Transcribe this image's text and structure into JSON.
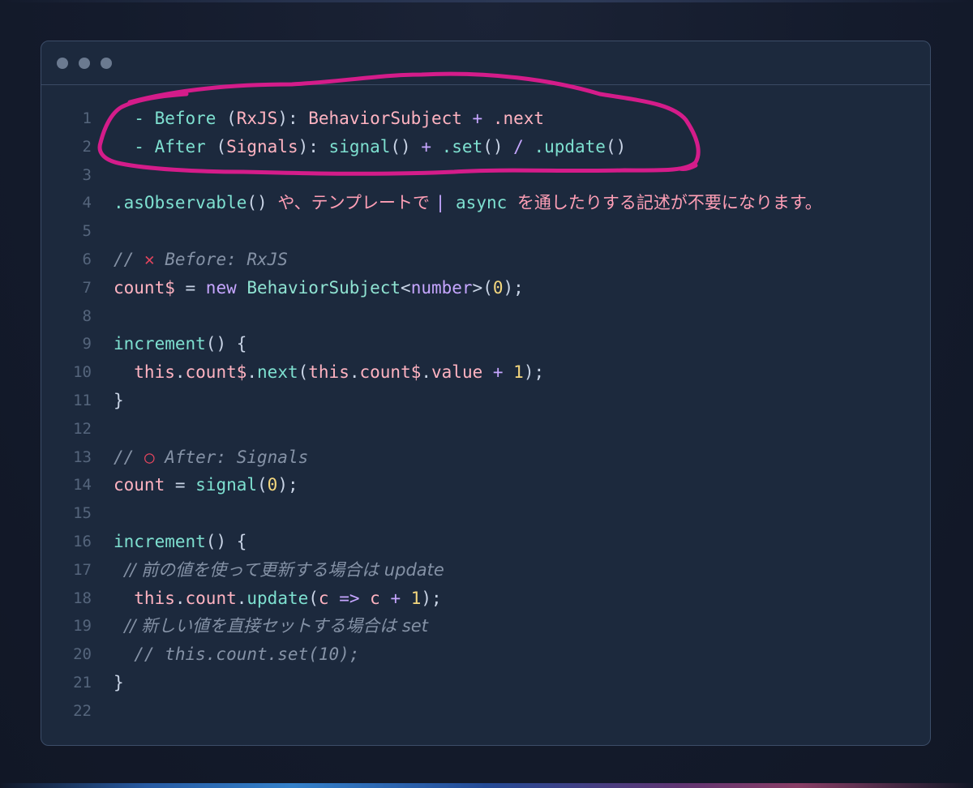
{
  "colors": {
    "window_bg": "#1c293d",
    "page_bg": "#141b2c",
    "highlight": "#d41c8a",
    "line_number": "#55657c"
  },
  "window": {
    "traffic_lights": [
      "window-dot",
      "window-dot",
      "window-dot"
    ]
  },
  "code_lines": [
    {
      "num": "1",
      "tokens": [
        {
          "t": "  - Before ",
          "c": "fn"
        },
        {
          "t": "(",
          "c": "paren"
        },
        {
          "t": "RxJS",
          "c": "prop"
        },
        {
          "t": "): ",
          "c": "paren"
        },
        {
          "t": "BehaviorSubject",
          "c": "prop"
        },
        {
          "t": " + ",
          "c": "op"
        },
        {
          "t": ".next",
          "c": "prop"
        }
      ]
    },
    {
      "num": "2",
      "tokens": [
        {
          "t": "  - After ",
          "c": "fn"
        },
        {
          "t": "(",
          "c": "paren"
        },
        {
          "t": "Signals",
          "c": "prop"
        },
        {
          "t": "): ",
          "c": "paren"
        },
        {
          "t": "signal",
          "c": "fn"
        },
        {
          "t": "() ",
          "c": "paren"
        },
        {
          "t": "+ ",
          "c": "op"
        },
        {
          "t": ".set",
          "c": "fn"
        },
        {
          "t": "() ",
          "c": "paren"
        },
        {
          "t": "/ ",
          "c": "op"
        },
        {
          "t": ".update",
          "c": "fn"
        },
        {
          "t": "()",
          "c": "paren"
        }
      ]
    },
    {
      "num": "3",
      "tokens": []
    },
    {
      "num": "4",
      "tokens": [
        {
          "t": ".asObservable",
          "c": "fn"
        },
        {
          "t": "() ",
          "c": "paren"
        },
        {
          "t": "や、テンプレートで ",
          "c": "jp"
        },
        {
          "t": "| ",
          "c": "pipe"
        },
        {
          "t": "async ",
          "c": "fn"
        },
        {
          "t": "を通したりする記述が不要になります。",
          "c": "jp"
        }
      ]
    },
    {
      "num": "5",
      "tokens": []
    },
    {
      "num": "6",
      "tokens": [
        {
          "t": "// ",
          "c": "com"
        },
        {
          "t": "✕",
          "c": "cross"
        },
        {
          "t": " Before: RxJS",
          "c": "com"
        }
      ]
    },
    {
      "num": "7",
      "tokens": [
        {
          "t": "count$",
          "c": "prop"
        },
        {
          "t": " = ",
          "c": "plain"
        },
        {
          "t": "new ",
          "c": "kw"
        },
        {
          "t": "BehaviorSubject",
          "c": "type"
        },
        {
          "t": "<",
          "c": "paren"
        },
        {
          "t": "number",
          "c": "kw"
        },
        {
          "t": ">(",
          "c": "paren"
        },
        {
          "t": "0",
          "c": "num"
        },
        {
          "t": ");",
          "c": "paren"
        }
      ]
    },
    {
      "num": "8",
      "tokens": []
    },
    {
      "num": "9",
      "tokens": [
        {
          "t": "increment",
          "c": "fn"
        },
        {
          "t": "() {",
          "c": "paren"
        }
      ]
    },
    {
      "num": "10",
      "tokens": [
        {
          "t": "  this",
          "c": "prop"
        },
        {
          "t": ".",
          "c": "plain"
        },
        {
          "t": "count$",
          "c": "prop"
        },
        {
          "t": ".",
          "c": "plain"
        },
        {
          "t": "next",
          "c": "fn"
        },
        {
          "t": "(",
          "c": "paren"
        },
        {
          "t": "this",
          "c": "prop"
        },
        {
          "t": ".",
          "c": "plain"
        },
        {
          "t": "count$",
          "c": "prop"
        },
        {
          "t": ".",
          "c": "plain"
        },
        {
          "t": "value",
          "c": "prop"
        },
        {
          "t": " + ",
          "c": "op"
        },
        {
          "t": "1",
          "c": "num"
        },
        {
          "t": ");",
          "c": "paren"
        }
      ]
    },
    {
      "num": "11",
      "tokens": [
        {
          "t": "}",
          "c": "paren"
        }
      ]
    },
    {
      "num": "12",
      "tokens": []
    },
    {
      "num": "13",
      "tokens": [
        {
          "t": "// ",
          "c": "com"
        },
        {
          "t": "○",
          "c": "circle"
        },
        {
          "t": " After: Signals",
          "c": "com"
        }
      ]
    },
    {
      "num": "14",
      "tokens": [
        {
          "t": "count",
          "c": "prop"
        },
        {
          "t": " = ",
          "c": "plain"
        },
        {
          "t": "signal",
          "c": "fn"
        },
        {
          "t": "(",
          "c": "paren"
        },
        {
          "t": "0",
          "c": "num"
        },
        {
          "t": ");",
          "c": "paren"
        }
      ]
    },
    {
      "num": "15",
      "tokens": []
    },
    {
      "num": "16",
      "tokens": [
        {
          "t": "increment",
          "c": "fn"
        },
        {
          "t": "() {",
          "c": "paren"
        }
      ]
    },
    {
      "num": "17",
      "tokens": [
        {
          "t": "  // 前の値を使って更新する場合は update",
          "c": "jpcom"
        }
      ]
    },
    {
      "num": "18",
      "tokens": [
        {
          "t": "  this",
          "c": "prop"
        },
        {
          "t": ".",
          "c": "plain"
        },
        {
          "t": "count",
          "c": "prop"
        },
        {
          "t": ".",
          "c": "plain"
        },
        {
          "t": "update",
          "c": "fn"
        },
        {
          "t": "(",
          "c": "paren"
        },
        {
          "t": "c",
          "c": "prop"
        },
        {
          "t": " => ",
          "c": "op"
        },
        {
          "t": "c",
          "c": "prop"
        },
        {
          "t": " + ",
          "c": "op"
        },
        {
          "t": "1",
          "c": "num"
        },
        {
          "t": ");",
          "c": "paren"
        }
      ]
    },
    {
      "num": "19",
      "tokens": [
        {
          "t": "  // 新しい値を直接セットする場合は set",
          "c": "jpcom"
        }
      ]
    },
    {
      "num": "20",
      "tokens": [
        {
          "t": "  // this.count.set(10);",
          "c": "com"
        }
      ]
    },
    {
      "num": "21",
      "tokens": [
        {
          "t": "}",
          "c": "paren"
        }
      ]
    },
    {
      "num": "22",
      "tokens": []
    }
  ]
}
